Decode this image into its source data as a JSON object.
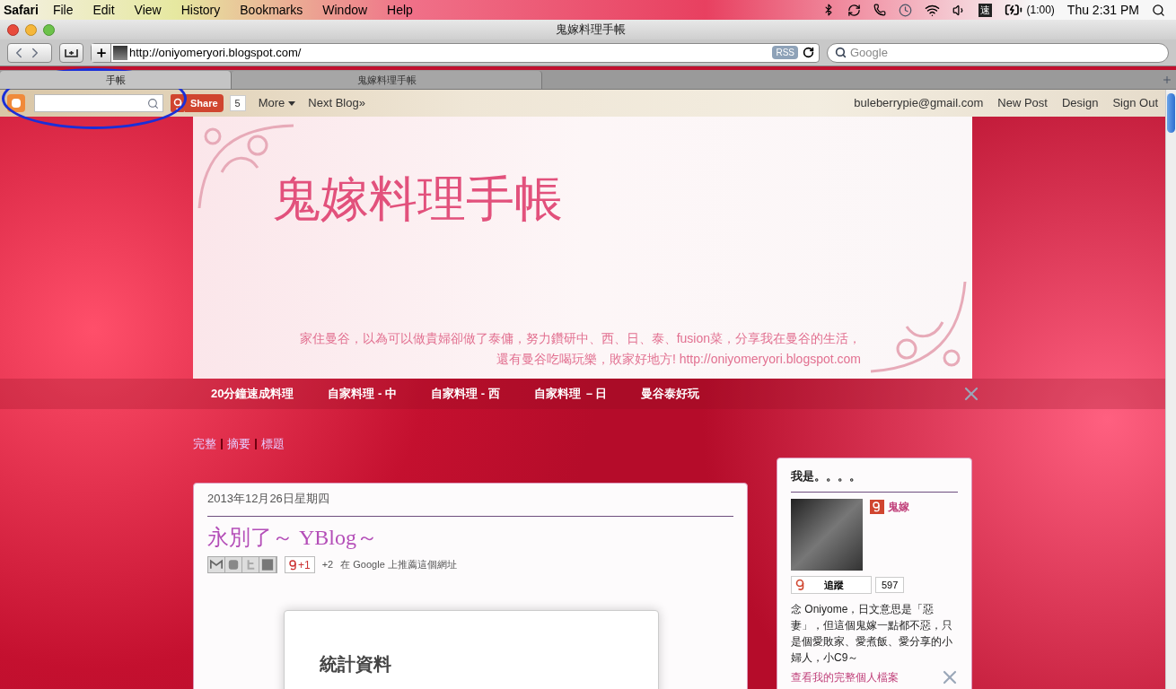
{
  "menu_bar": {
    "app": "Safari",
    "items": [
      "File",
      "Edit",
      "View",
      "History",
      "Bookmarks",
      "Window",
      "Help"
    ],
    "input_method": "速",
    "battery": "(1:00)",
    "clock": "Thu 2:31 PM"
  },
  "window": {
    "title": "鬼嫁料理手帳"
  },
  "toolbar": {
    "url": "http://oniyomeryori.blogspot.com/",
    "rss": "RSS",
    "search": {
      "placeholder": "Google"
    }
  },
  "tabs": [
    {
      "label": "手帳",
      "selected": true
    },
    {
      "label": "鬼嫁料理手帳",
      "selected": false
    }
  ],
  "blogger_bar": {
    "share": "Share",
    "share_count": "5",
    "more": "More",
    "next_blog": "Next Blog»",
    "email": "buleberrypie@gmail.com",
    "links": [
      "New Post",
      "Design",
      "Sign Out"
    ]
  },
  "header": {
    "title": "鬼嫁料理手帳",
    "tagline": [
      "家住曼谷，以為可以做貴婦卻做了泰傭，努力鑽研中、西、日、泰、fusion菜，分享我在曼谷的生活，",
      "還有曼谷吃喝玩樂，敗家好地方! http://oniyomeryori.blogspot.com"
    ]
  },
  "nav": [
    "20分鐘速成料理",
    "自家料理 - 中",
    "自家料理 - 西",
    "自家料理 －日",
    "曼谷泰好玩"
  ],
  "views": [
    "完整",
    "摘要",
    "標題"
  ],
  "post": {
    "date": "2013年12月26日星期四",
    "title": "永別了～ YBlog～",
    "plus_one": "+1",
    "plus_count": "+2",
    "recommend": "在 Google 上推薦這個網址",
    "box_heading": "統計資料"
  },
  "sidebar": {
    "title": "我是。。。。",
    "name": "鬼嫁",
    "follow": "追蹤",
    "followers": "597",
    "bio": "念 Oniyome，日文意思是「惡妻」，但這個鬼嫁一點都不惡，只是個愛敗家、愛煮飯、愛分享的小婦人，小C9～",
    "profile_link": "查看我的完整個人檔案"
  }
}
